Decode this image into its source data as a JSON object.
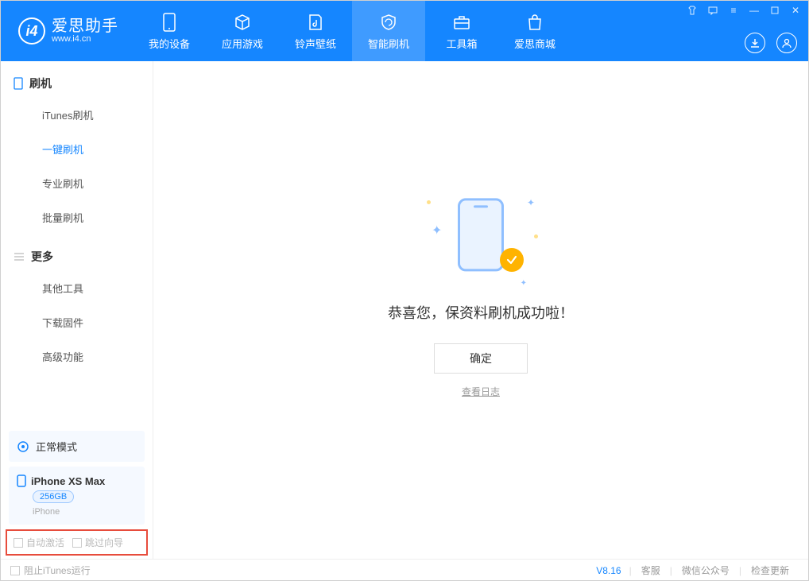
{
  "logo": {
    "cn": "爱思助手",
    "en": "www.i4.cn",
    "mark": "i4"
  },
  "nav": [
    {
      "label": "我的设备"
    },
    {
      "label": "应用游戏"
    },
    {
      "label": "铃声壁纸"
    },
    {
      "label": "智能刷机"
    },
    {
      "label": "工具箱"
    },
    {
      "label": "爱思商城"
    }
  ],
  "sidebar": {
    "group1": {
      "title": "刷机",
      "items": [
        "iTunes刷机",
        "一键刷机",
        "专业刷机",
        "批量刷机"
      ]
    },
    "group2": {
      "title": "更多",
      "items": [
        "其他工具",
        "下载固件",
        "高级功能"
      ]
    }
  },
  "mode": {
    "label": "正常模式"
  },
  "device": {
    "name": "iPhone XS Max",
    "capacity": "256GB",
    "type": "iPhone"
  },
  "options": {
    "auto_activate": "自动激活",
    "skip_wizard": "跳过向导"
  },
  "main": {
    "success": "恭喜您，保资料刷机成功啦！",
    "ok": "确定",
    "view_log": "查看日志"
  },
  "footer": {
    "block_itunes": "阻止iTunes运行",
    "version": "V8.16",
    "service": "客服",
    "wechat": "微信公众号",
    "check_update": "检查更新"
  }
}
